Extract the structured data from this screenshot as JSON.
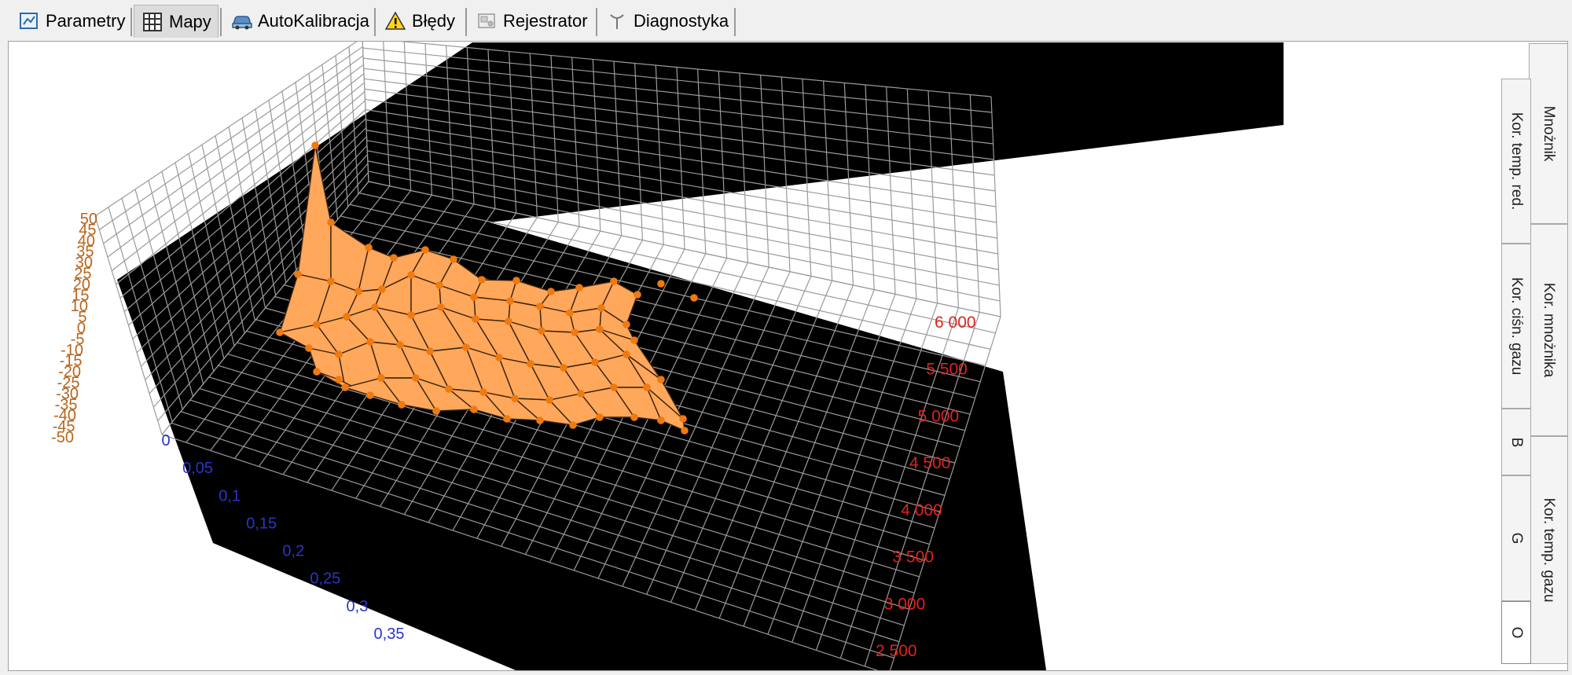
{
  "tabs": [
    {
      "label": "Parametry",
      "icon": "parameters-icon",
      "active": false
    },
    {
      "label": "Mapy",
      "icon": "grid-map-icon",
      "active": true
    },
    {
      "label": "AutoKalibracja",
      "icon": "car-icon",
      "active": false
    },
    {
      "label": "Błędy",
      "icon": "warning-icon",
      "active": false
    },
    {
      "label": "Rejestrator",
      "icon": "recorder-icon",
      "active": false
    },
    {
      "label": "Diagnostyka",
      "icon": "antenna-icon",
      "active": false
    }
  ],
  "side_tabs": {
    "outer": [
      "Mnożnik",
      "Kor. mnożnika",
      "Kor. temp. gazu"
    ],
    "inner": [
      "Kor. temp. red.",
      "Kor. ciśn. gazu",
      "B",
      "G",
      "O"
    ],
    "selected": "O"
  },
  "colors": {
    "surface": "#ffa75a",
    "surface_edge": "#3a2410",
    "points": "#ee7a10",
    "grid": "#9a9a9a",
    "background": "#000000"
  },
  "chart_data": {
    "type": "surface",
    "z_ticks": [
      "50",
      "45",
      "40",
      "35",
      "30",
      "25",
      "20",
      "15",
      "10",
      "5",
      "0",
      "-5",
      "-10",
      "-15",
      "-20",
      "-25",
      "-30",
      "-35",
      "-40",
      "-45",
      "-50"
    ],
    "x_ticks": [
      "0",
      "0,05",
      "0,1",
      "0,15",
      "0,2",
      "0,25",
      "0,3",
      "0,35"
    ],
    "y_ticks": [
      "6 000",
      "5 500",
      "5 000",
      "4 500",
      "4 000",
      "3 500",
      "3 000",
      "2 500"
    ],
    "zlim": [
      -50,
      50
    ]
  }
}
